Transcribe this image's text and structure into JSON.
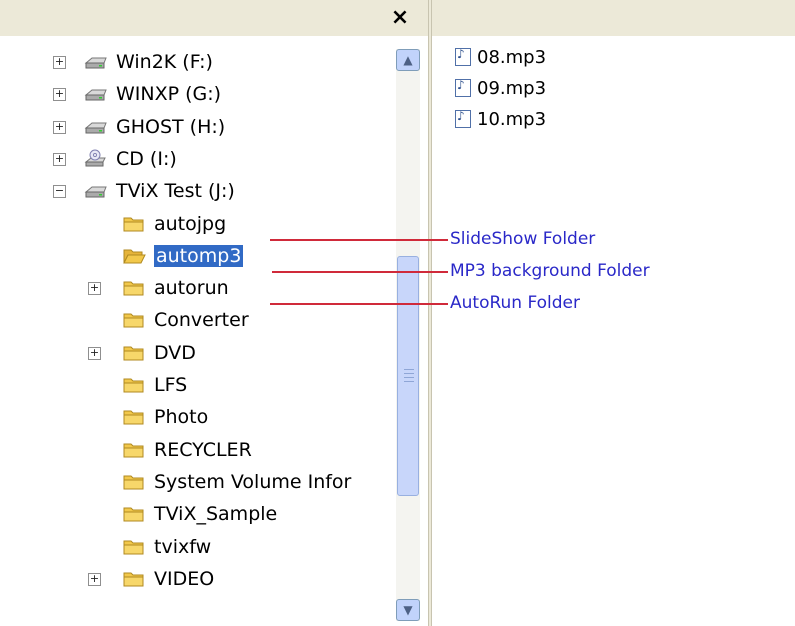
{
  "window": {
    "close_glyph": "×"
  },
  "tree": [
    {
      "label": "Win2K (F:)",
      "icon": "drive-icon",
      "expander": "+"
    },
    {
      "label": "WINXP (G:)",
      "icon": "drive-icon",
      "expander": "+"
    },
    {
      "label": "GHOST (H:)",
      "icon": "drive-icon",
      "expander": "+"
    },
    {
      "label": "CD (I:)",
      "icon": "cd-drive-icon",
      "expander": "+"
    },
    {
      "label": "TViX Test (J:)",
      "icon": "drive-icon",
      "expander": "−"
    },
    {
      "label": "autojpg",
      "icon": "folder-icon"
    },
    {
      "label": "automp3",
      "icon": "folder-open-icon",
      "selected": true
    },
    {
      "label": "autorun",
      "icon": "folder-icon",
      "expander": "+"
    },
    {
      "label": "Converter",
      "icon": "folder-icon"
    },
    {
      "label": "DVD",
      "icon": "folder-icon",
      "expander": "+"
    },
    {
      "label": "LFS",
      "icon": "folder-icon"
    },
    {
      "label": "Photo",
      "icon": "folder-icon"
    },
    {
      "label": "RECYCLER",
      "icon": "folder-icon"
    },
    {
      "label": "System Volume Infor",
      "icon": "folder-icon"
    },
    {
      "label": "TViX_Sample",
      "icon": "folder-icon"
    },
    {
      "label": "tvixfw",
      "icon": "folder-icon"
    },
    {
      "label": "VIDEO",
      "icon": "folder-icon",
      "expander": "+"
    }
  ],
  "files": [
    "08.mp3",
    "09.mp3",
    "10.mp3"
  ],
  "annotations": [
    "SlideShow Folder",
    "MP3 background Folder",
    "AutoRun Folder"
  ],
  "colors": {
    "selection": "#316ac5",
    "annotation_text": "#2a28c8",
    "annotation_line": "#d02a3a",
    "folder": "#f2c84b"
  }
}
